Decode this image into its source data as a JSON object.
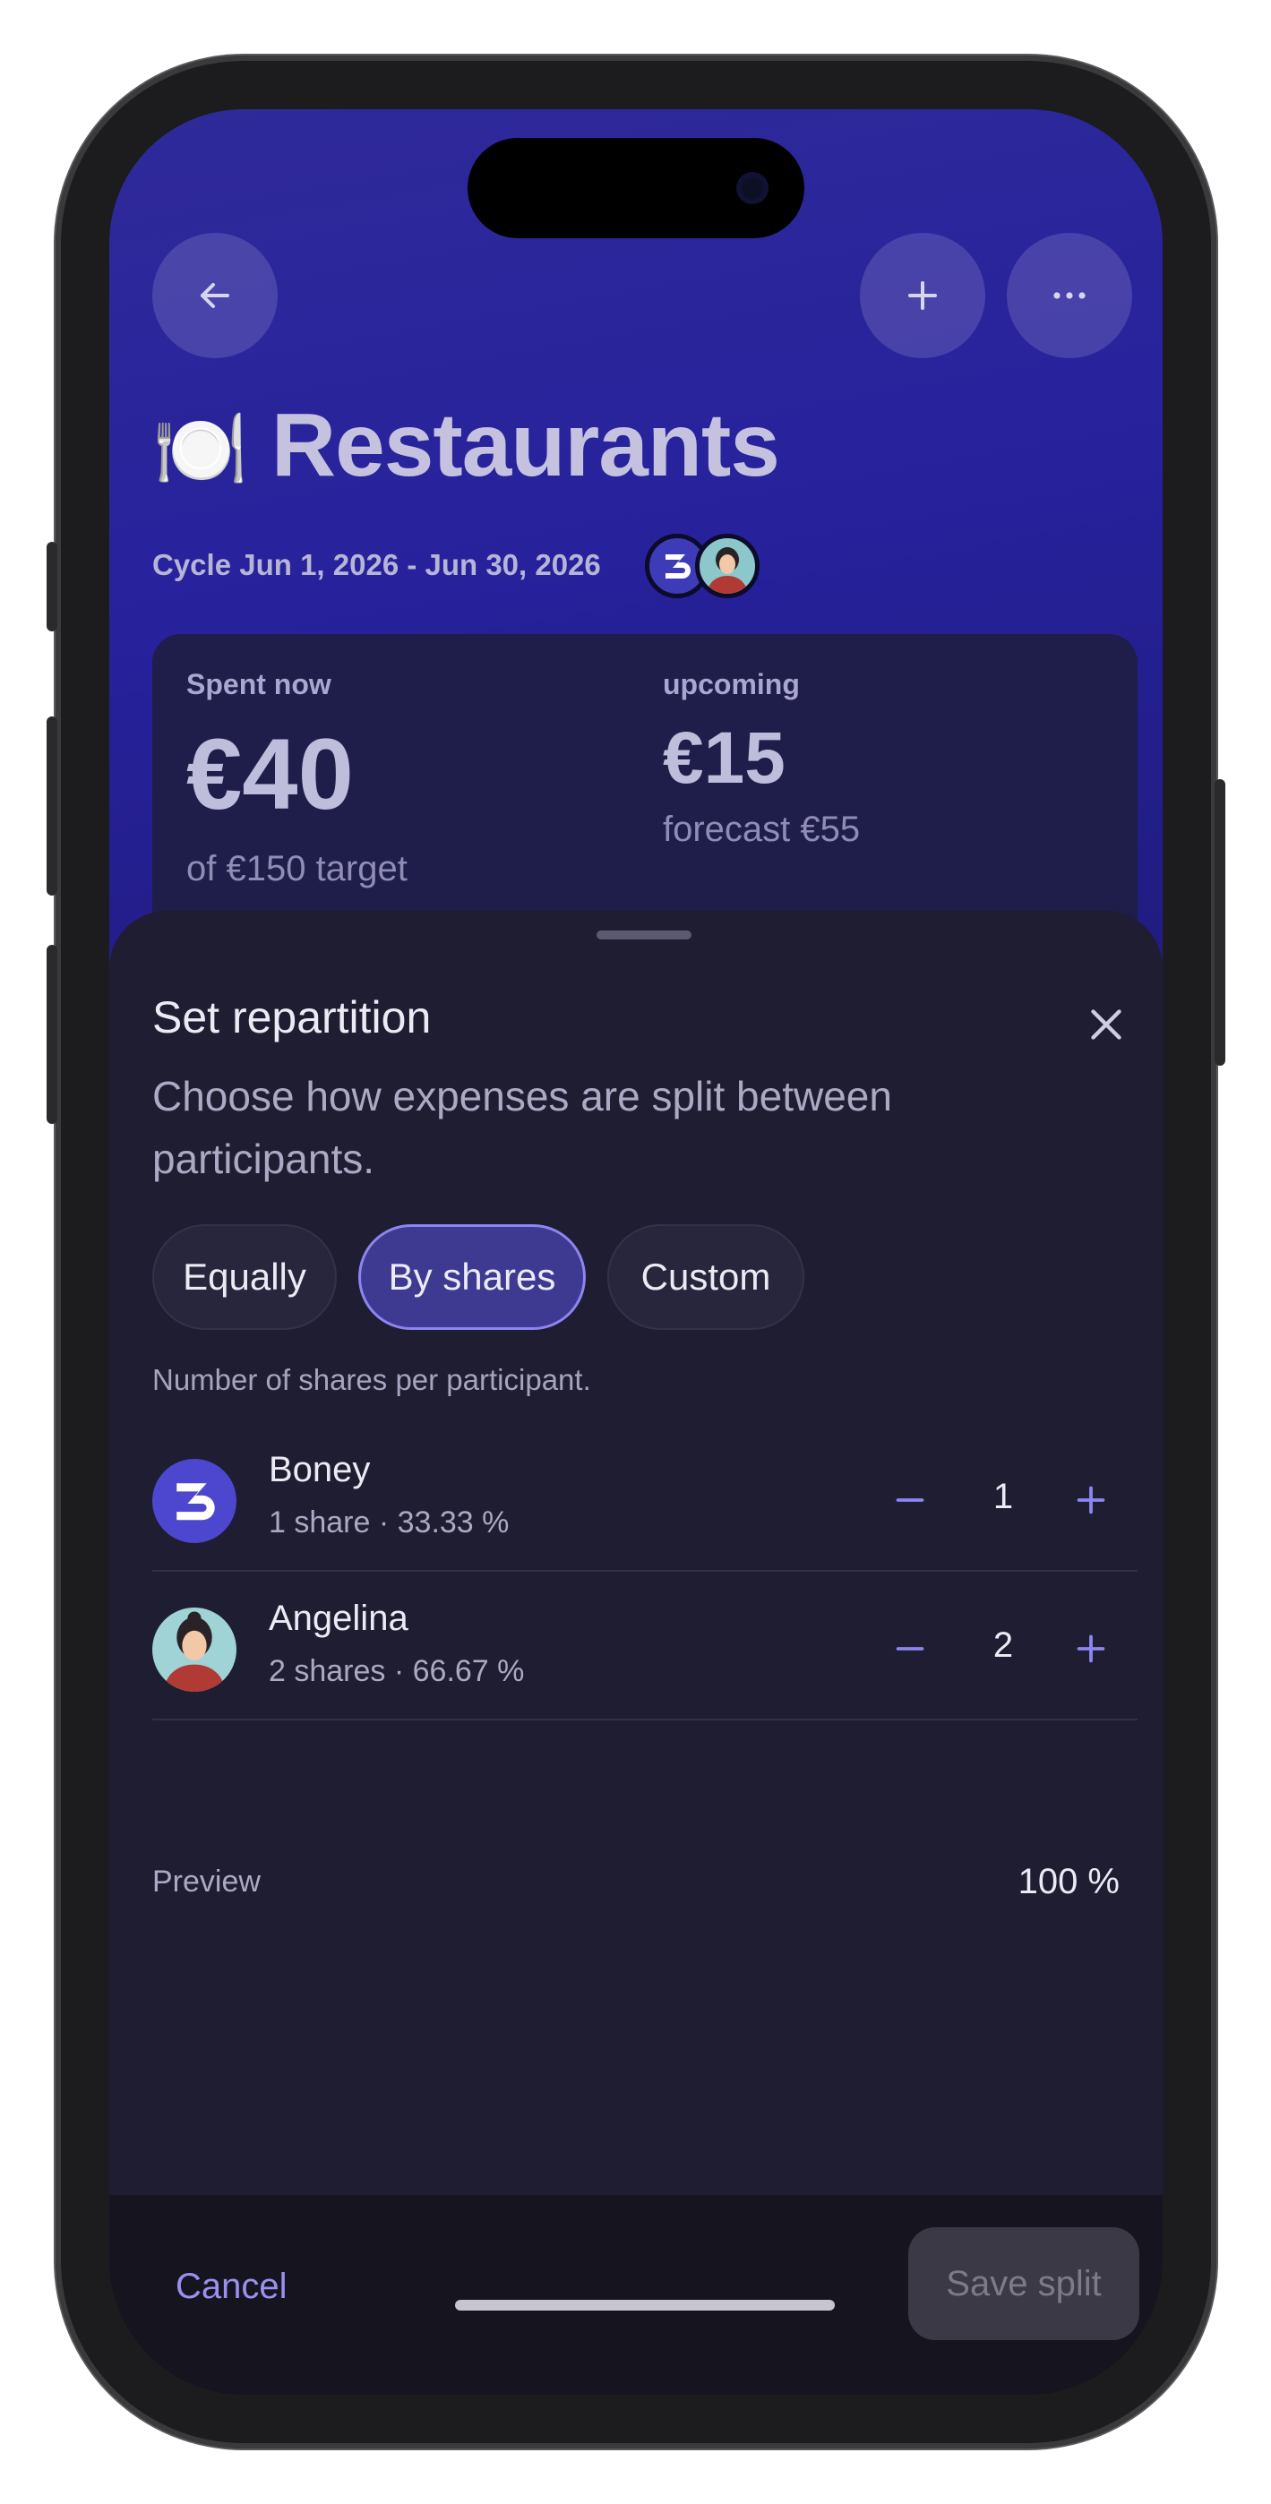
{
  "header": {
    "title_emoji": "🍽️",
    "title": "Restaurants",
    "cycle": "Cycle Jun 1, 2026 - Jun 30, 2026",
    "back_icon": "arrow-left-icon",
    "add_icon": "plus-icon",
    "more_icon": "more-horizontal-icon"
  },
  "summary": {
    "spent_label": "Spent now",
    "spent_value": "€40",
    "target": "of €150 target",
    "upcoming_label": "upcoming",
    "upcoming_value": "€15",
    "forecast": "forecast €55"
  },
  "sheet": {
    "title": "Set repartition",
    "description": "Choose how expenses are split between participants.",
    "modes": [
      "Equally",
      "By shares",
      "Custom"
    ],
    "selected_mode": "By shares",
    "hint": "Number of shares per participant.",
    "participants": [
      {
        "name": "Boney",
        "meta": "1 share · 33.33 %",
        "shares": "1",
        "avatar": "logo-b-avatar"
      },
      {
        "name": "Angelina",
        "meta": "2 shares · 66.67 %",
        "shares": "2",
        "avatar": "woman-avatar"
      }
    ],
    "preview_label": "Preview",
    "preview_value": "100 %"
  },
  "footer": {
    "cancel": "Cancel",
    "save": "Save split"
  },
  "colors": {
    "accent": "#8d85f1",
    "hero": "#27219c",
    "sheet_bg": "#1f1d31"
  }
}
